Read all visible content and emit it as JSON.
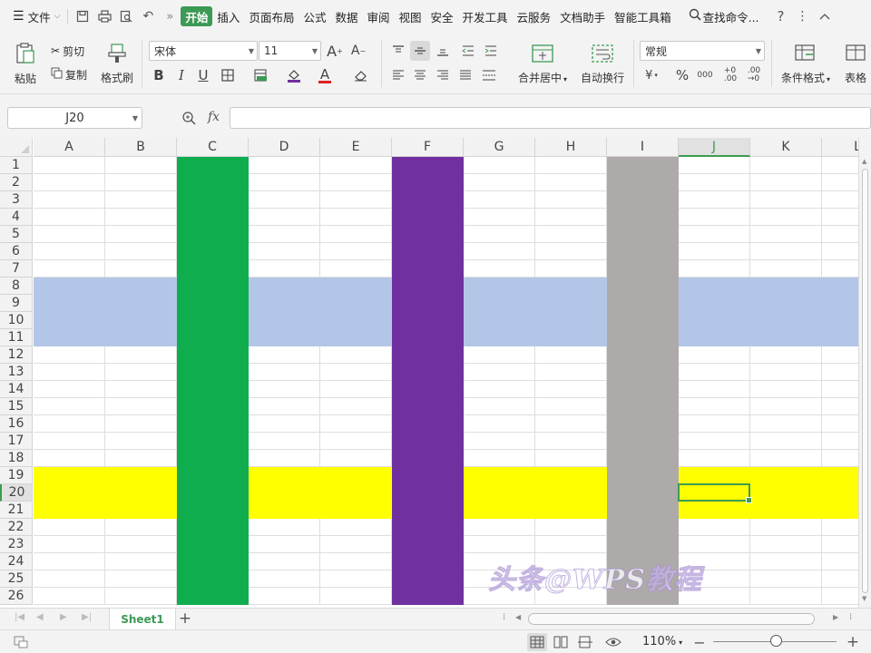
{
  "menubar": {
    "file_label": "文件",
    "tabs": [
      "开始",
      "插入",
      "页面布局",
      "公式",
      "数据",
      "审阅",
      "视图",
      "安全",
      "开发工具",
      "云服务",
      "文档助手",
      "智能工具箱"
    ],
    "search_label": "查找命令...",
    "accent_color": "#3c9a55"
  },
  "ribbon": {
    "paste_label": "粘贴",
    "cut_label": "剪切",
    "copy_label": "复制",
    "format_painter_label": "格式刷",
    "font_name": "宋体",
    "font_size": "11",
    "merge_center_label": "合并居中",
    "wrap_text_label": "自动换行",
    "number_format": "常规",
    "conditional_format_label": "条件格式",
    "table_style_label": "表格"
  },
  "formula_bar": {
    "name_box": "J20",
    "fx_label": "fx",
    "formula": ""
  },
  "grid": {
    "columns": [
      "A",
      "B",
      "C",
      "D",
      "E",
      "F",
      "G",
      "H",
      "I",
      "J",
      "K",
      "L"
    ],
    "rows": [
      "1",
      "2",
      "3",
      "4",
      "5",
      "6",
      "7",
      "8",
      "9",
      "10",
      "11",
      "12",
      "13",
      "14",
      "15",
      "16",
      "17",
      "18",
      "19",
      "20",
      "21",
      "22",
      "23",
      "24",
      "25",
      "26"
    ],
    "selected_cell": "J20",
    "column_fills": {
      "C": "#0fad4e",
      "F": "#7030a0",
      "I": "#aeaaaa"
    },
    "row_fills": [
      {
        "rows": [
          "8",
          "9",
          "10",
          "11"
        ],
        "color": "#b4c6e7"
      },
      {
        "rows": [
          "19",
          "20",
          "21"
        ],
        "color": "#ffff00"
      }
    ]
  },
  "watermark": "头条@WPS教程",
  "sheets": {
    "active_sheet": "Sheet1",
    "add_label": "+"
  },
  "status": {
    "zoom_level": "110%",
    "zoom_minus": "−",
    "zoom_plus": "+"
  }
}
